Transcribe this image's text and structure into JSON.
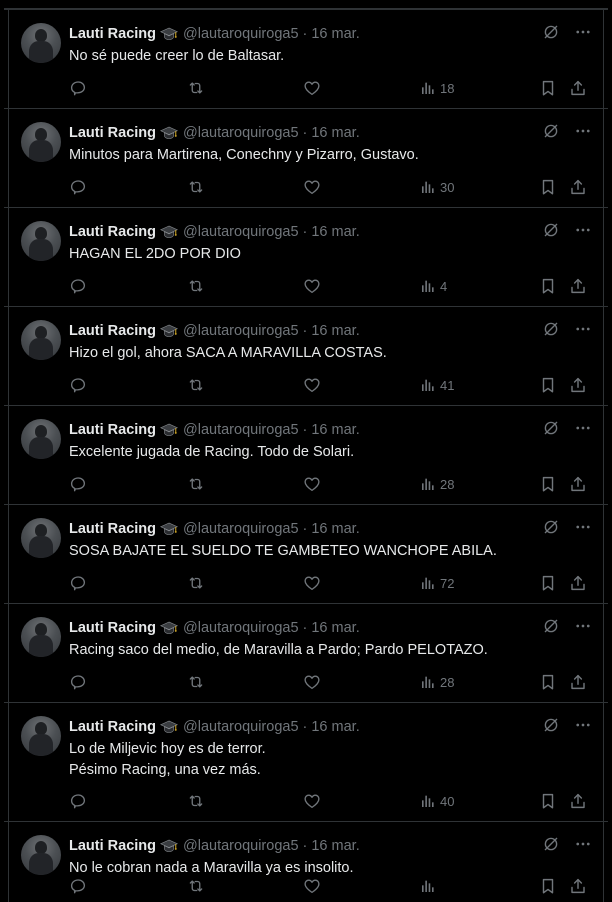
{
  "author": {
    "display_name": "Lauti Racing",
    "handle": "@lautaroquiroga5",
    "separator": "·",
    "badge_icon": "graduation-cap-icon",
    "avatar_icon": "avatar-photo"
  },
  "icons": {
    "grok": "grok-icon",
    "more": "more-icon",
    "reply": "reply-icon",
    "retweet": "retweet-icon",
    "like": "heart-icon",
    "views": "views-icon",
    "bookmark": "bookmark-icon",
    "share": "share-icon"
  },
  "colors": {
    "background": "#000000",
    "text": "#e7e9ea",
    "muted": "#71767b",
    "border": "#2f3336"
  },
  "tweets": [
    {
      "date": "16 mar.",
      "lines": [
        "No sé puede creer lo de Baltasar."
      ],
      "views": "18"
    },
    {
      "date": "16 mar.",
      "lines": [
        "Minutos para Martirena, Conechny y Pizarro, Gustavo."
      ],
      "views": "30"
    },
    {
      "date": "16 mar.",
      "lines": [
        "HAGAN EL 2DO POR DIO"
      ],
      "views": "4"
    },
    {
      "date": "16 mar.",
      "lines": [
        "Hizo el gol, ahora SACA A MARAVILLA COSTAS."
      ],
      "views": "41"
    },
    {
      "date": "16 mar.",
      "lines": [
        "Excelente jugada de Racing. Todo de Solari."
      ],
      "views": "28"
    },
    {
      "date": "16 mar.",
      "lines": [
        "SOSA BAJATE EL SUELDO TE GAMBETEO WANCHOPE ABILA."
      ],
      "views": "72"
    },
    {
      "date": "16 mar.",
      "lines": [
        "Racing saco del medio, de Maravilla a Pardo; Pardo PELOTAZO."
      ],
      "views": "28"
    },
    {
      "date": "16 mar.",
      "lines": [
        "Lo de Miljevic hoy es de terror.",
        "Pésimo Racing, una vez más."
      ],
      "views": "40"
    },
    {
      "date": "16 mar.",
      "lines": [
        "No le cobran nada a Maravilla ya es insolito."
      ],
      "views": ""
    }
  ]
}
